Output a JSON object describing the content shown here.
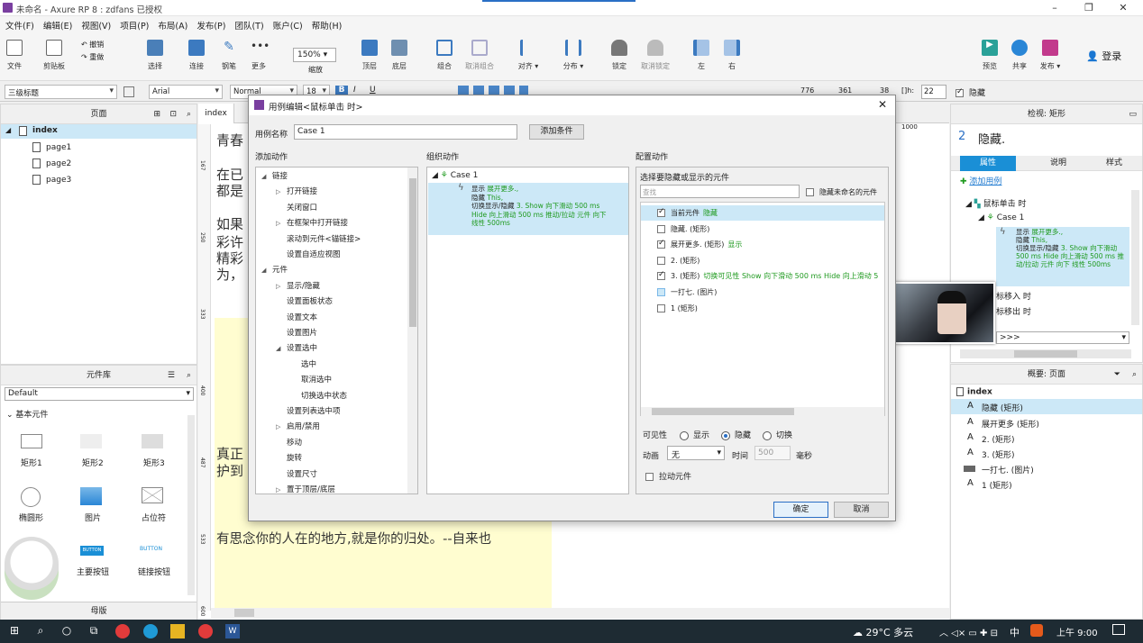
{
  "app": {
    "title": "未命名 - Axure RP 8 : zdfans 已授权"
  },
  "menu": [
    "文件(F)",
    "编辑(E)",
    "视图(V)",
    "项目(P)",
    "布局(A)",
    "发布(P)",
    "团队(T)",
    "账户(C)",
    "帮助(H)"
  ],
  "toolbar": {
    "items": [
      "文件",
      "剪贴板",
      "选择",
      "连接",
      "钢笔",
      "更多",
      "缩放",
      "顶层",
      "底层",
      "组合",
      "取消组合",
      "对齐",
      "分布",
      "锁定",
      "取消锁定",
      "左",
      "右",
      "预览",
      "共享",
      "发布"
    ],
    "zoom": "150%",
    "undo": "撤销",
    "redo": "重做",
    "login": "登录"
  },
  "format": {
    "style": "三级标题",
    "font": "Arial",
    "font2": "Normal",
    "size": "18",
    "x": "776",
    "y": "361",
    "w": "38",
    "h": "22",
    "hidden_label": "隐藏"
  },
  "pages": {
    "title": "页面",
    "root": "index",
    "items": [
      "page1",
      "page2",
      "page3"
    ]
  },
  "library": {
    "title": "元件库",
    "select": "Default",
    "section": "基本元件",
    "items": [
      "矩形1",
      "矩形2",
      "矩形3",
      "椭圆形",
      "图片",
      "占位符",
      "主要按钮",
      "链接按钮"
    ],
    "button_text": "BUTTON",
    "masters": "母版"
  },
  "canvas": {
    "tab": "index",
    "ruler_v": [
      "167",
      "250",
      "333",
      "400",
      "487",
      "533",
      "600"
    ],
    "ruler_h": "1000",
    "texts": [
      "青春",
      "在已",
      "都是",
      "如果",
      "彩许",
      "精彩",
      "为，",
      "真正",
      "护到"
    ],
    "bottom_text": "有思念你的人在的地方,就是你的归处。--自来也"
  },
  "inspector": {
    "title": "检视: 矩形",
    "number": "2",
    "name": "隐藏.",
    "tabs": [
      "属性",
      "说明",
      "样式"
    ],
    "add_case": "添加用例",
    "event": "鼠标单击 时",
    "case": "Case 1",
    "case_detail": [
      {
        "t": "显示 ",
        "c": "展开更多.,"
      },
      {
        "t": "隐藏 ",
        "c": "This,"
      },
      {
        "t": "切换显示/隐藏 ",
        "c": "3. Show 向下滑动 500 ms Hide 向上滑动 500 ms 推动/拉动 元件 向下 线性 500ms"
      }
    ],
    "events_more": [
      "标移入 时",
      "标移出 时"
    ],
    "more": ">>>"
  },
  "outline": {
    "title": "概要: 页面",
    "root": "index",
    "items": [
      "隐藏 (矩形)",
      "展开更多 (矩形)",
      "2. (矩形)",
      "3. (矩形)",
      "一打七. (图片)",
      "1 (矩形)"
    ]
  },
  "dialog": {
    "title": "用例编辑<鼠标单击 时>",
    "case_name_label": "用例名称",
    "case_name": "Case 1",
    "add_condition": "添加条件",
    "col1_title": "添加动作",
    "col2_title": "组织动作",
    "col3_title": "配置动作",
    "actions": [
      {
        "l": "链接",
        "lvl": 0,
        "exp": "open"
      },
      {
        "l": "打开链接",
        "lvl": 1,
        "exp": "closed"
      },
      {
        "l": "关闭窗口",
        "lvl": 1
      },
      {
        "l": "在框架中打开链接",
        "lvl": 1,
        "exp": "closed"
      },
      {
        "l": "滚动到元件<锚链接>",
        "lvl": 1
      },
      {
        "l": "设置自适应视图",
        "lvl": 1
      },
      {
        "l": "元件",
        "lvl": 0,
        "exp": "open"
      },
      {
        "l": "显示/隐藏",
        "lvl": 1,
        "exp": "closed"
      },
      {
        "l": "设置面板状态",
        "lvl": 1
      },
      {
        "l": "设置文本",
        "lvl": 1
      },
      {
        "l": "设置图片",
        "lvl": 1
      },
      {
        "l": "设置选中",
        "lvl": 1,
        "exp": "open"
      },
      {
        "l": "选中",
        "lvl": 2
      },
      {
        "l": "取消选中",
        "lvl": 2
      },
      {
        "l": "切换选中状态",
        "lvl": 2
      },
      {
        "l": "设置列表选中项",
        "lvl": 1
      },
      {
        "l": "启用/禁用",
        "lvl": 1,
        "exp": "closed"
      },
      {
        "l": "移动",
        "lvl": 1
      },
      {
        "l": "旋转",
        "lvl": 1
      },
      {
        "l": "设置尺寸",
        "lvl": 1
      },
      {
        "l": "置于顶层/底层",
        "lvl": 1,
        "exp": "closed"
      }
    ],
    "organize": {
      "case": "Case 1",
      "lines": [
        {
          "t": "显示 ",
          "c": "展开更多.,"
        },
        {
          "t": "隐藏 ",
          "c": "This,"
        },
        {
          "t": "切换显示/隐藏 ",
          "c": "3. Show 向下滑动 500 ms"
        },
        {
          "t": "",
          "c": "Hide 向上滑动 500 ms 推动/拉动 元件 向下"
        },
        {
          "t": "",
          "c": "线性 500ms"
        }
      ]
    },
    "config": {
      "subtitle": "选择要隐藏或显示的元件",
      "search_placeholder": "查找",
      "hide_unnamed": "隐藏未命名的元件",
      "list": [
        {
          "name": "当前元件",
          "action": "隐藏",
          "checked": true,
          "sel": true
        },
        {
          "name": "隐藏. (矩形)",
          "action": "",
          "checked": false
        },
        {
          "name": "展开更多. (矩形)",
          "action": "显示",
          "checked": true
        },
        {
          "name": "2. (矩形)",
          "action": "",
          "checked": false
        },
        {
          "name": "3. (矩形)",
          "action": "切换可见性 Show 向下滑动 500 ms Hide 向上滑动 5",
          "checked": true
        },
        {
          "name": "一打七. (图片)",
          "action": "",
          "checked": false,
          "partial": true
        },
        {
          "name": "1 (矩形)",
          "action": "",
          "checked": false
        }
      ],
      "visibility_label": "可见性",
      "vis_options": [
        "显示",
        "隐藏",
        "切换"
      ],
      "vis_selected": 1,
      "anim_label": "动画",
      "anim_value": "无",
      "time_label": "时间",
      "time_value": "500",
      "ms_label": "毫秒",
      "push_label": "拉动元件"
    },
    "ok": "确定",
    "cancel": "取消"
  },
  "taskbar": {
    "weather": "29°C 多云",
    "time": "上午 9:00",
    "ime": "中"
  },
  "colors": {
    "accent": "#2a6fc5",
    "selection": "#cce8f7",
    "green": "#1f9a1f",
    "inspector_tab": "#1a8fd6"
  }
}
